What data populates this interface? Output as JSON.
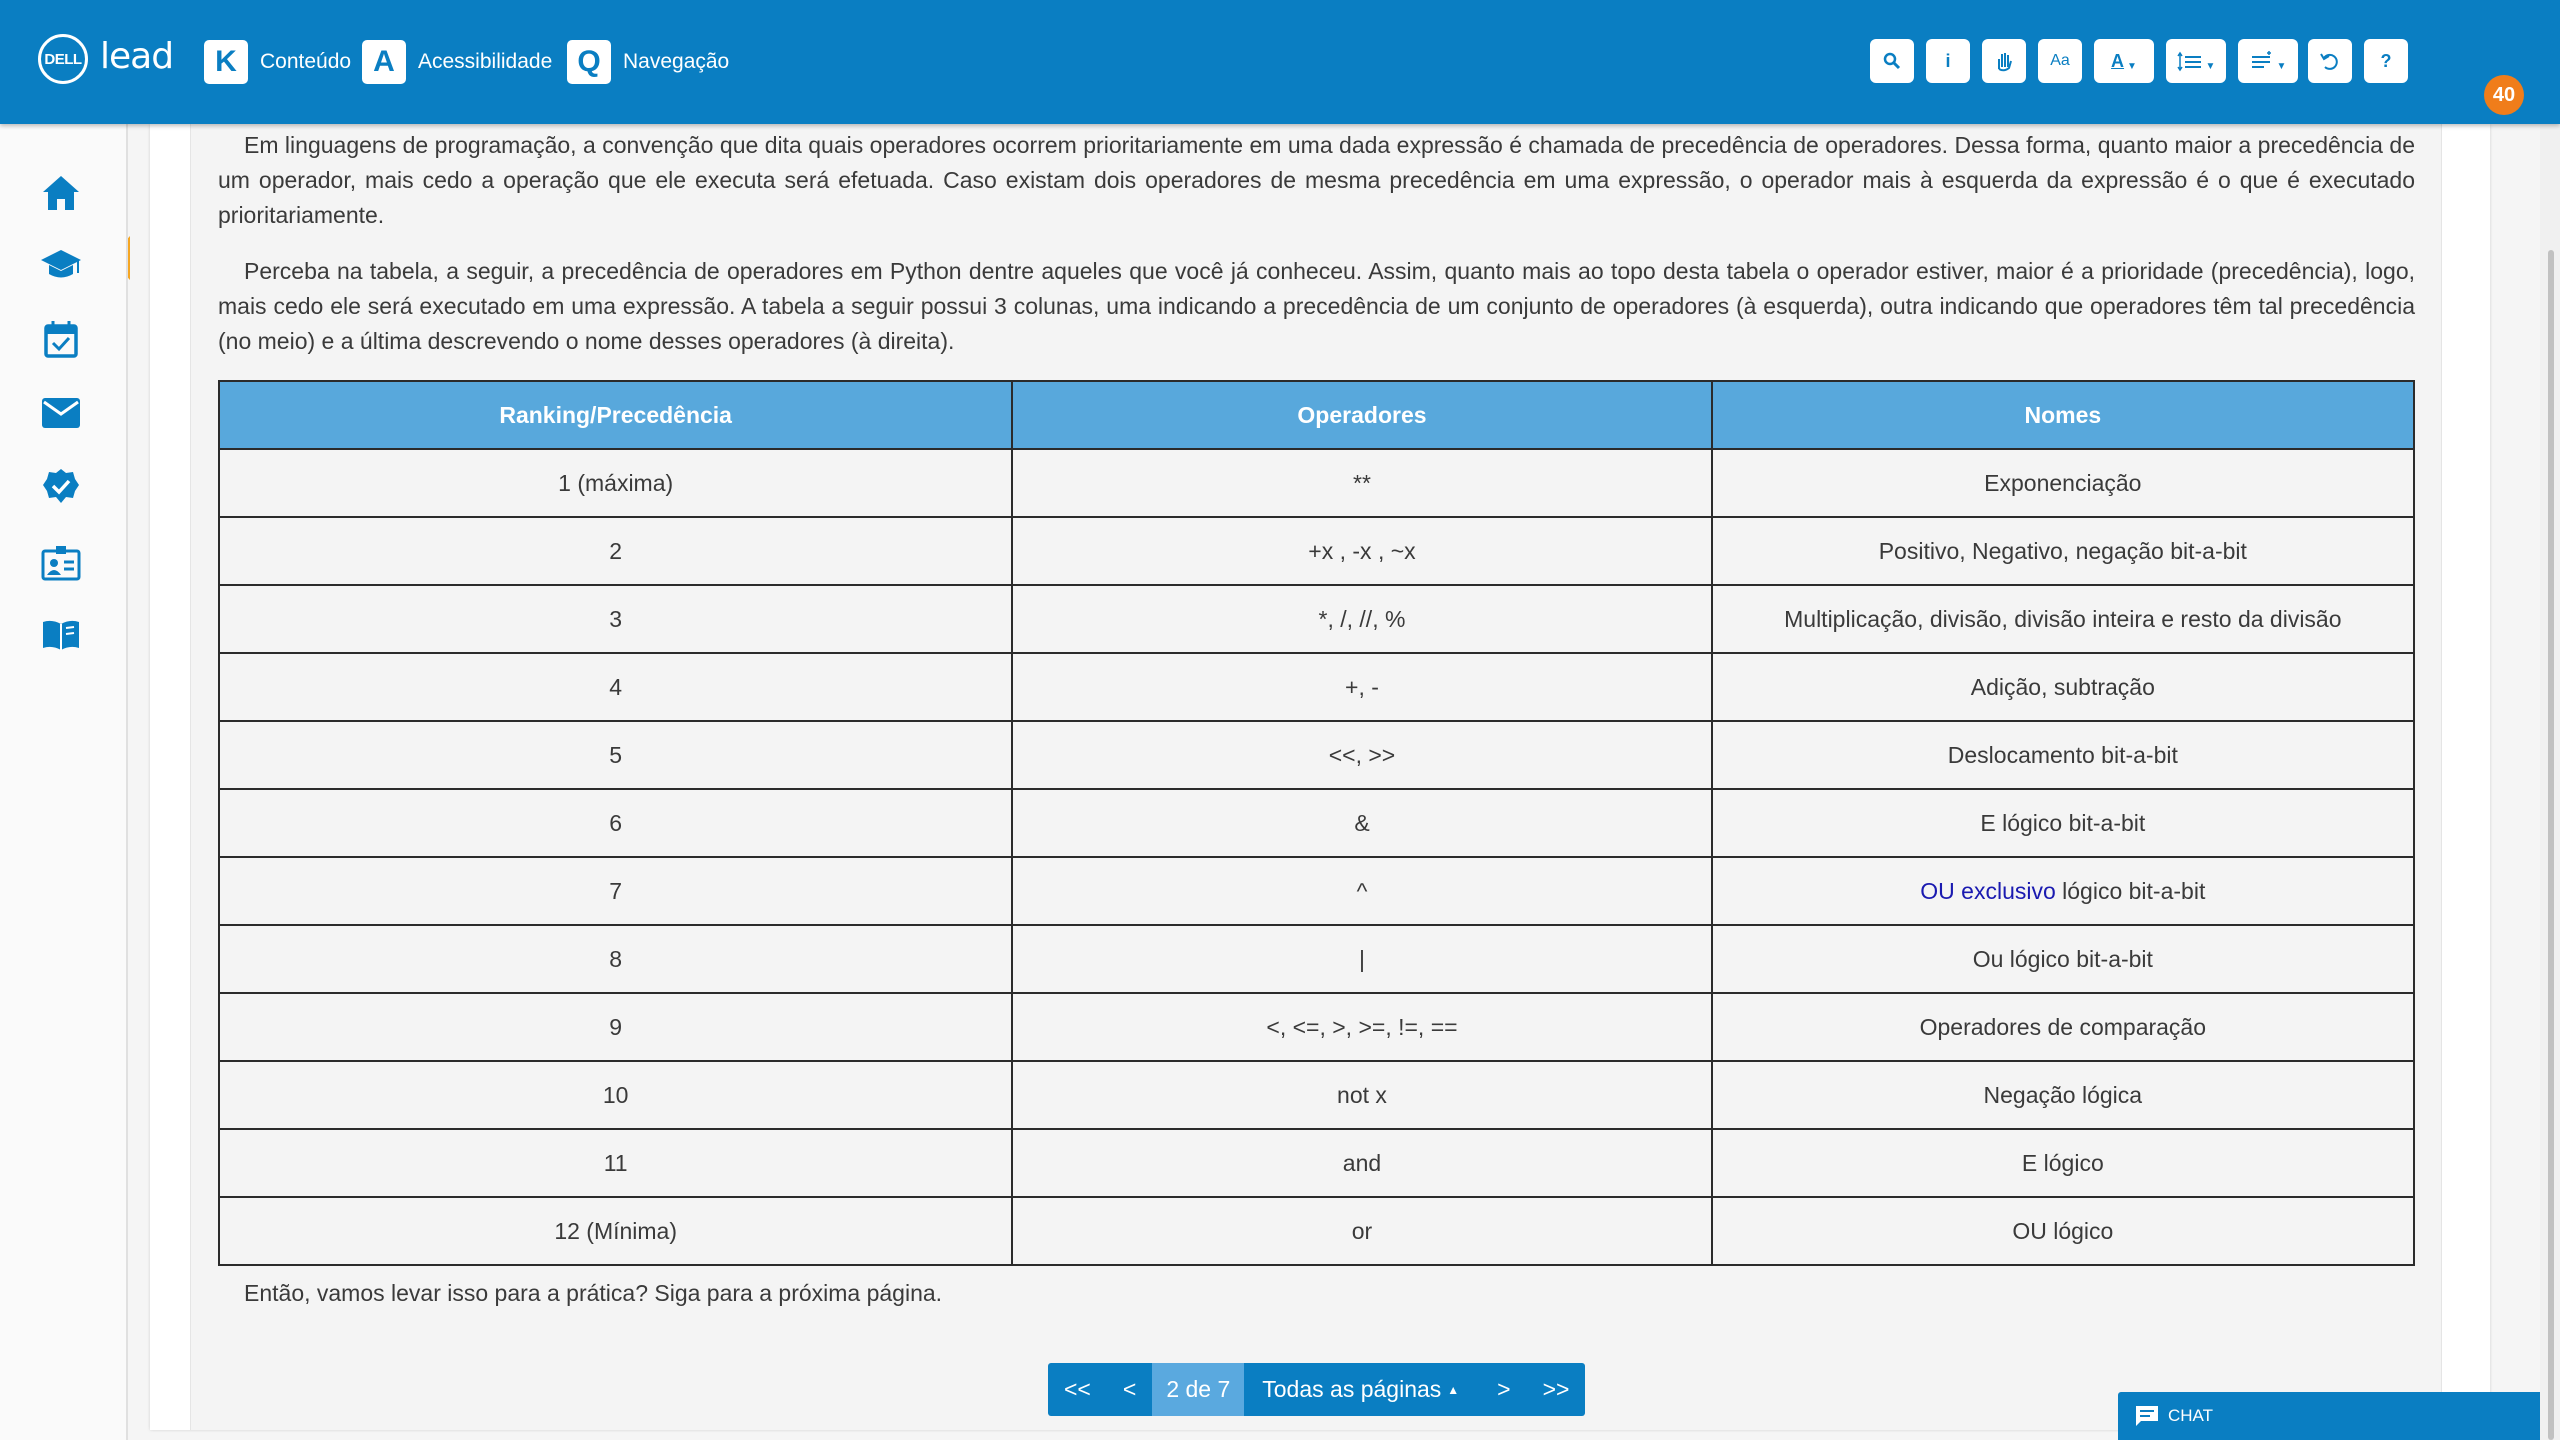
{
  "header": {
    "logo_dell": "DELL",
    "logo_lead": "lead",
    "shortcuts": [
      {
        "key": "K",
        "label": "Conteúdo"
      },
      {
        "key": "A",
        "label": "Acessibilidade"
      },
      {
        "key": "Q",
        "label": "Navegação"
      }
    ],
    "tools": {
      "info": "i",
      "font_size": "Aa",
      "font_color": "A",
      "help": "?"
    },
    "avatar_badge": "40"
  },
  "sidebar": {
    "items": [
      {
        "icon": "home-icon"
      },
      {
        "icon": "graduation-cap-icon"
      },
      {
        "icon": "calendar-check-icon"
      },
      {
        "icon": "mail-icon"
      },
      {
        "icon": "verified-badge-icon"
      },
      {
        "icon": "id-card-icon"
      },
      {
        "icon": "open-book-icon"
      }
    ],
    "active_index": 1
  },
  "content": {
    "paragraph1": "Em linguagens de programação, a convenção que dita quais operadores ocorrem prioritariamente em uma dada expressão é chamada de precedência de operadores. Dessa forma, quanto maior a precedência de um operador, mais cedo a operação que ele executa será efetuada. Caso existam dois operadores de mesma precedência em uma expressão, o operador mais à esquerda da expressão é o que é executado prioritariamente.",
    "paragraph2": "Perceba na tabela, a seguir, a precedência de operadores em Python dentre aqueles que você já conheceu. Assim, quanto mais ao topo desta tabela o operador estiver, maior é a prioridade (precedência), logo, mais cedo ele será executado em uma expressão. A tabela a seguir possui 3 colunas, uma indicando a precedência de um conjunto de operadores (à esquerda), outra indicando que operadores têm tal precedência (no meio) e a última descrevendo o nome desses operadores (à direita).",
    "table": {
      "headers": [
        "Ranking/Precedência",
        "Operadores",
        "Nomes"
      ],
      "rows": [
        [
          "1 (máxima)",
          "**",
          "Exponenciação"
        ],
        [
          "2",
          "+x , -x , ~x",
          "Positivo, Negativo, negação bit-a-bit"
        ],
        [
          "3",
          "*, /, //, %",
          "Multiplicação, divisão, divisão inteira e resto da divisão"
        ],
        [
          "4",
          "+, -",
          "Adição, subtração"
        ],
        [
          "5",
          "<<, >>",
          "Deslocamento bit-a-bit"
        ],
        [
          "6",
          "&",
          "E lógico bit-a-bit"
        ],
        [
          "7",
          "^",
          "lógico bit-a-bit"
        ],
        [
          "8",
          "|",
          "Ou lógico bit-a-bit"
        ],
        [
          "9",
          "<, <=, >, >=, !=, ==",
          "Operadores de comparação"
        ],
        [
          "10",
          "not x",
          "Negação lógica"
        ],
        [
          "11",
          "and",
          "E lógico"
        ],
        [
          "12 (Mínima)",
          "or",
          "OU lógico"
        ]
      ],
      "row7_link": "OU exclusivo"
    },
    "outro": "Então, vamos levar isso para a prática? Siga para a próxima página."
  },
  "pagination": {
    "first": "<<",
    "prev": "<",
    "current": "2 de 7",
    "all_pages": "Todas as páginas",
    "next": ">",
    "last": ">>"
  },
  "chat": {
    "label": "CHAT"
  },
  "colors": {
    "primary": "#0a7ec2",
    "table_header": "#58a8dc",
    "active_marker": "#f5a623",
    "badge": "#f07d1a",
    "link": "#1a1ab0"
  }
}
